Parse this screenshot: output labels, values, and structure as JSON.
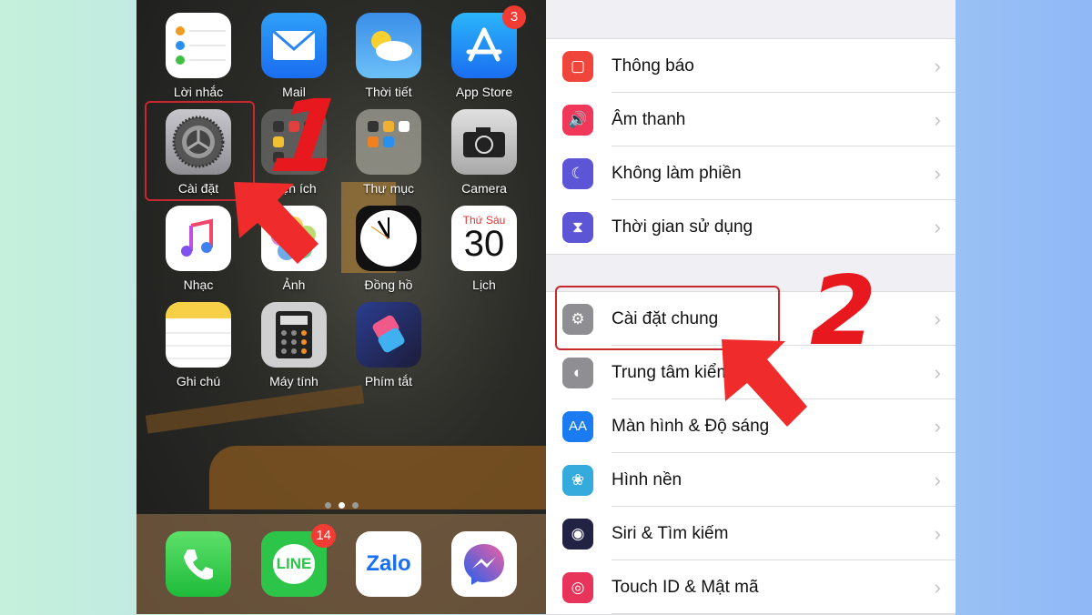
{
  "home_screen": {
    "apps": [
      {
        "label": "Lời nhắc",
        "icon": "reminders-icon"
      },
      {
        "label": "Mail",
        "icon": "mail-icon"
      },
      {
        "label": "Thời tiết",
        "icon": "weather-icon"
      },
      {
        "label": "App Store",
        "icon": "app-store-icon",
        "badge": "3"
      },
      {
        "label": "Cài đặt",
        "icon": "settings-gear-icon"
      },
      {
        "label": "Tiện ích",
        "icon": "utilities-folder-icon"
      },
      {
        "label": "Thư mục",
        "icon": "folder-icon"
      },
      {
        "label": "Camera",
        "icon": "camera-icon"
      },
      {
        "label": "Nhạc",
        "icon": "music-icon"
      },
      {
        "label": "Ảnh",
        "icon": "photos-icon"
      },
      {
        "label": "Đồng hồ",
        "icon": "clock-icon"
      },
      {
        "label": "Lịch",
        "icon": "calendar-icon",
        "weekday": "Thứ Sáu",
        "day": "30"
      },
      {
        "label": "Ghi chú",
        "icon": "notes-icon"
      },
      {
        "label": "Máy tính",
        "icon": "calculator-icon"
      },
      {
        "label": "Phím tắt",
        "icon": "shortcuts-icon"
      }
    ],
    "dock": [
      {
        "icon": "phone-icon"
      },
      {
        "icon": "line-icon",
        "text": "LINE",
        "badge": "14"
      },
      {
        "icon": "zalo-icon",
        "text": "Zalo"
      },
      {
        "icon": "messenger-icon"
      }
    ],
    "step_number": "1"
  },
  "settings": {
    "group1": [
      {
        "label": "Thông báo",
        "icon": "notifications-icon",
        "color": "#f0453a"
      },
      {
        "label": "Âm thanh",
        "icon": "sounds-icon",
        "color": "#f0385a"
      },
      {
        "label": "Không làm phiền",
        "icon": "moon-icon",
        "color": "#5c55d6"
      },
      {
        "label": "Thời gian sử dụng",
        "icon": "hourglass-icon",
        "color": "#5c55d6"
      }
    ],
    "group2": [
      {
        "label": "Cài đặt chung",
        "icon": "gear-icon",
        "color": "#8e8e93"
      },
      {
        "label": "Trung tâm kiểm soát",
        "icon": "toggles-icon",
        "color": "#8e8e93"
      },
      {
        "label": "Màn hình & Độ sáng",
        "icon": "display-icon",
        "color": "#1a7cf0",
        "glyph": "AA"
      },
      {
        "label": "Hình nền",
        "icon": "wallpaper-icon",
        "color": "#35aadc"
      },
      {
        "label": "Siri & Tìm kiếm",
        "icon": "siri-icon",
        "color": "#222244"
      },
      {
        "label": "Touch ID & Mật mã",
        "icon": "fingerprint-icon",
        "color": "#e8345a"
      }
    ],
    "step_number": "2"
  },
  "colors": {
    "annotation": "#e8191e",
    "highlight": "#c8282d"
  }
}
